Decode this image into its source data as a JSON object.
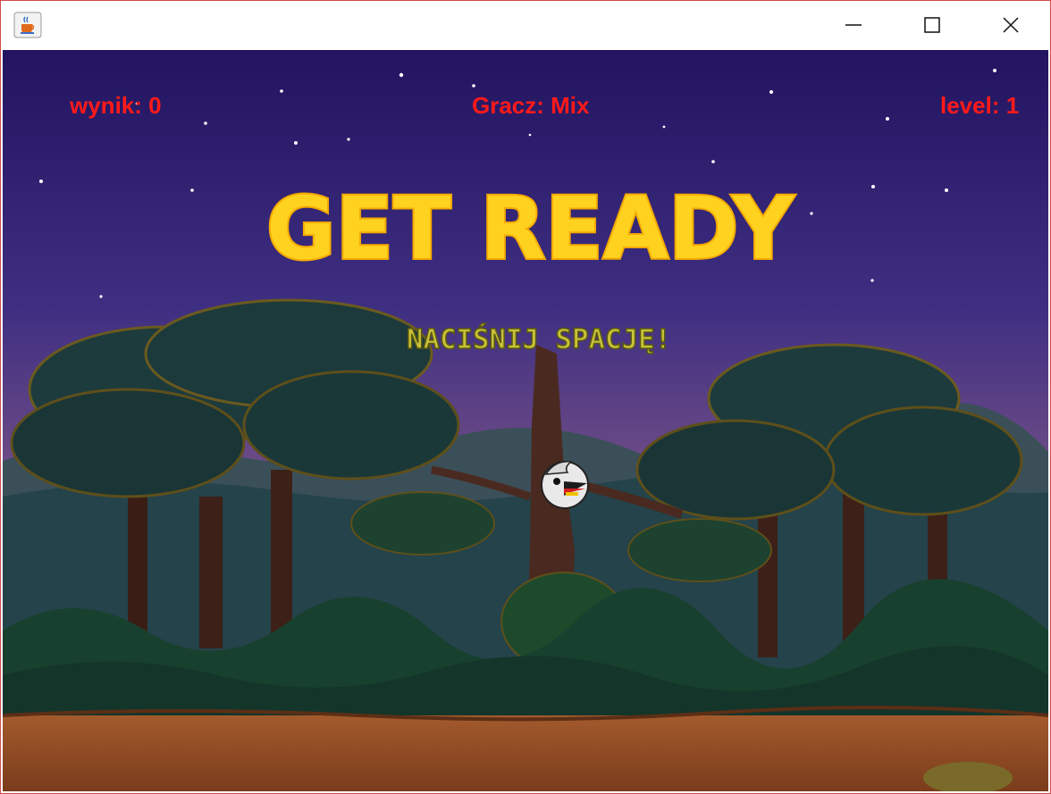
{
  "window": {
    "title_icon": "java-coffee-cup-icon",
    "controls": [
      "minimize-icon",
      "maximize-icon",
      "close-icon"
    ]
  },
  "hud": {
    "score_label": "wynik: 0",
    "player_label": "Gracz: Mix",
    "level_label": "level: 1"
  },
  "overlay": {
    "title": "GET READY",
    "subtitle": "NACIŚNIJ SPACJĘ!"
  },
  "colors": {
    "hud_text": "#ff1a1a",
    "title_fill": "#ffd21f",
    "subtitle_fill": "#c9c23a"
  }
}
